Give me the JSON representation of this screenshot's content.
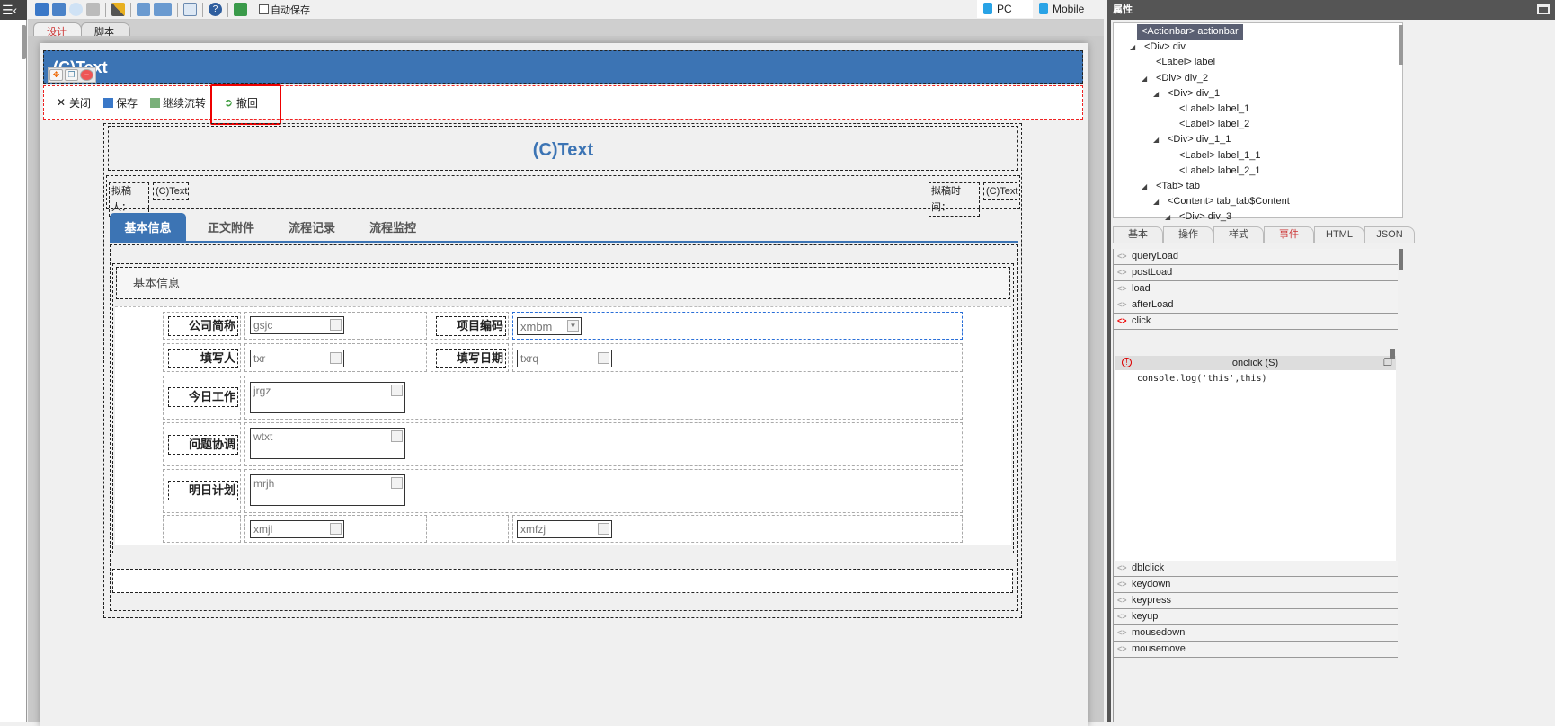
{
  "toolbar": {
    "autosave_label": "自动保存",
    "devices": [
      "PC",
      "Mobile"
    ],
    "icons": [
      "save-icon",
      "save-as-icon",
      "preview-icon",
      "print-icon",
      "wand-icon",
      "import-icon",
      "export-icon",
      "layout-icon",
      "help-icon",
      "layers-icon"
    ]
  },
  "editor_tabs": [
    "设计",
    "脚本"
  ],
  "page": {
    "header_text": "(C)Text",
    "actions": [
      {
        "label": "关闭",
        "icon": "close-icon"
      },
      {
        "label": "保存",
        "icon": "save-icon"
      },
      {
        "label": "继续流转",
        "icon": "forward-icon"
      },
      {
        "label": "撤回",
        "icon": "undo-icon"
      }
    ],
    "title": "(C)Text",
    "drafter_label": "拟稿人：",
    "drafter_value": "(C)Text",
    "draft_time_label": "拟稿时间：",
    "draft_time_value": "(C)Text",
    "tabs": [
      "基本信息",
      "正文附件",
      "流程记录",
      "流程监控"
    ],
    "section_title": "基本信息",
    "fields": {
      "company": {
        "label": "公司简称",
        "value": "gsjc"
      },
      "project_code": {
        "label": "项目编码",
        "value": "xmbm"
      },
      "filler": {
        "label": "填写人",
        "value": "txr"
      },
      "fill_date": {
        "label": "填写日期",
        "value": "txrq"
      },
      "today_work": {
        "label": "今日工作",
        "value": "jrgz"
      },
      "issues": {
        "label": "问题协调",
        "value": "wtxt"
      },
      "tomorrow_plan": {
        "label": "明日计划",
        "value": "mrjh"
      },
      "xmjl": {
        "value": "xmjl"
      },
      "xmfzj": {
        "value": "xmfzj"
      }
    }
  },
  "properties": {
    "title": "属性",
    "tree": [
      "<Actionbar> actionbar",
      "<Div> div",
      "<Label> label",
      "<Div> div_2",
      "<Div> div_1",
      "<Label> label_1",
      "<Label> label_2",
      "<Div> div_1_1",
      "<Label> label_1_1",
      "<Label> label_2_1",
      "<Tab> tab",
      "<Content> tab_tab$Content",
      "<Div> div_3"
    ],
    "tabs": [
      "基本",
      "操作",
      "样式",
      "事件",
      "HTML",
      "JSON"
    ],
    "events_top": [
      "queryLoad",
      "postLoad",
      "load",
      "afterLoad",
      "click"
    ],
    "onclick_header": "onclick (S)",
    "onclick_code": "console.log('this',this)",
    "events_bottom": [
      "dblclick",
      "keydown",
      "keypress",
      "keyup",
      "mousedown",
      "mousemove"
    ]
  }
}
